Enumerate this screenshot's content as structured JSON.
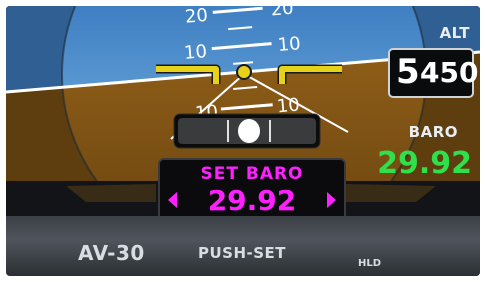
{
  "attitude": {
    "pitch_labels": [
      "20",
      "20",
      "10",
      "10",
      "10",
      "10"
    ]
  },
  "altitude": {
    "label": "ALT",
    "thousands": "5",
    "hundreds": "450"
  },
  "baro": {
    "label": "BARO",
    "value": "29.92"
  },
  "set_baro_popup": {
    "title": "SET BARO",
    "value": "29.92"
  },
  "bezel": {
    "brand": "AV-30",
    "knob_label": "PUSH-SET",
    "hold_label": "HLD"
  },
  "colors": {
    "sky": "#4a88c8",
    "ground": "#8a5a17",
    "aircraft_symbol": "#e7d21a",
    "baro_value": "#2fe04a",
    "set_baro": "#ff20ff"
  }
}
